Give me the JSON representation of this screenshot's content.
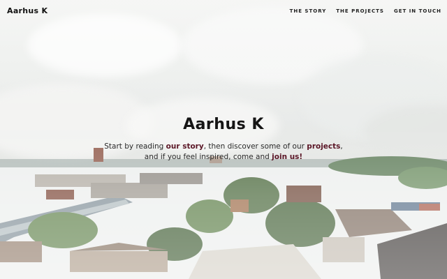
{
  "header": {
    "logo": "Aarhus K",
    "nav": [
      {
        "label": "THE STORY"
      },
      {
        "label": "THE PROJECTS"
      },
      {
        "label": "GET IN TOUCH"
      }
    ]
  },
  "intro": {
    "brand": "Aarhus K",
    "line1_a": "Start by reading ",
    "link_story": "our story",
    "line1_b": ", then discover some of our ",
    "link_projects": "projects",
    "line1_c": ",",
    "line2_a": "and if you feel inspired, come and ",
    "link_join": "join us!"
  },
  "colors": {
    "link": "#5a1626",
    "text": "#2a2a2a"
  }
}
